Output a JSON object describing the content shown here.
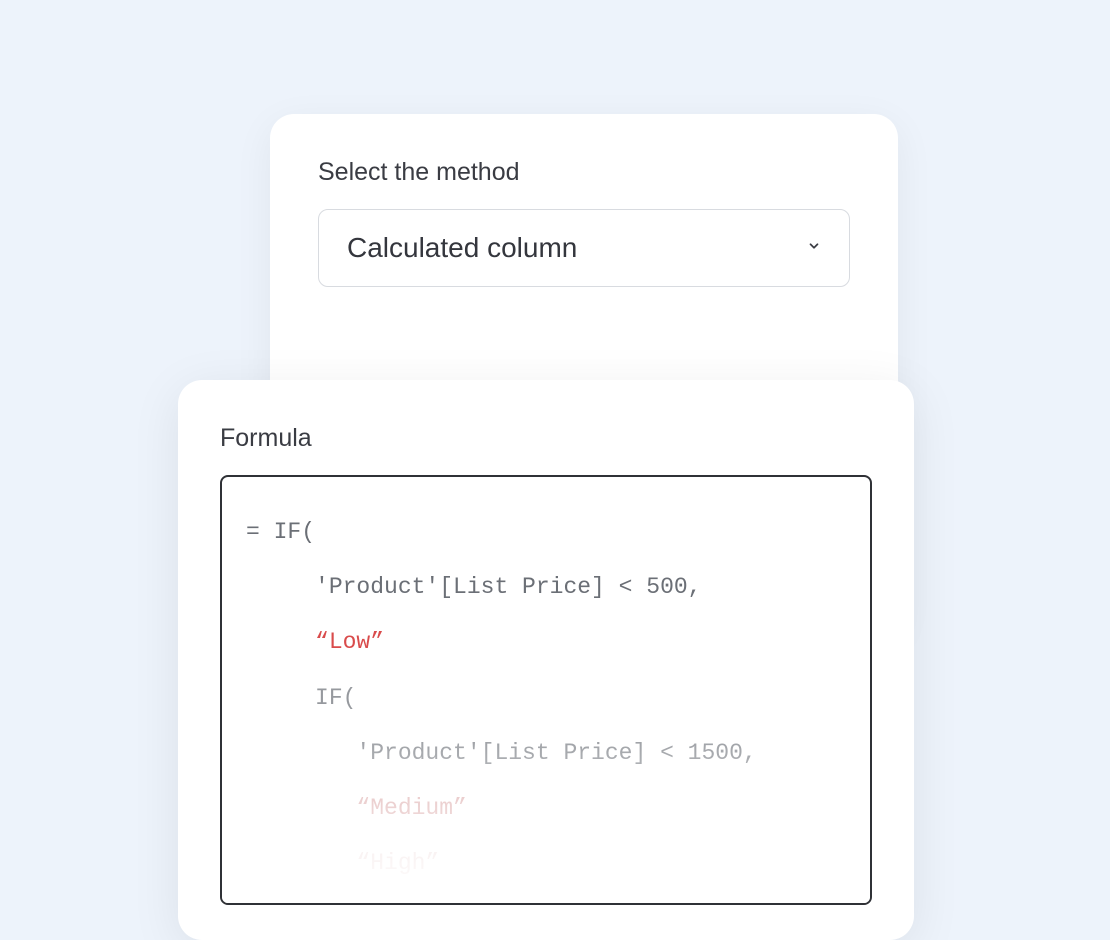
{
  "method": {
    "label": "Select the method",
    "selected": "Calculated column"
  },
  "formula": {
    "label": "Formula",
    "tokens": {
      "eq": "=",
      "if": "IF(",
      "cond1": "'Product'[List Price] < 500,",
      "low": "“Low”",
      "cond2": "'Product'[List Price] < 1500,",
      "medium": "“Medium”",
      "high": "“High”"
    }
  }
}
